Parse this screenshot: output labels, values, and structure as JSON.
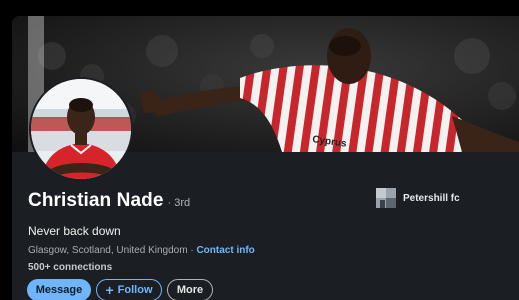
{
  "profile": {
    "name": "Christian Nade",
    "degree": "· 3rd",
    "headline": "Never back down",
    "location": "Glasgow, Scotland, United Kingdom",
    "separator": " · ",
    "contact_info_label": "Contact info",
    "connections": "500+ connections"
  },
  "company": {
    "name": "Petershill fc"
  },
  "actions": {
    "message_label": "Message",
    "follow_plus": "+",
    "follow_label": "Follow",
    "more_label": "More"
  },
  "colors": {
    "page_background": "#000000",
    "card_background": "#1b1f23",
    "link_blue": "#71b7fb",
    "primary_button": "#70b5f9",
    "kit_red": "#c8262c"
  }
}
